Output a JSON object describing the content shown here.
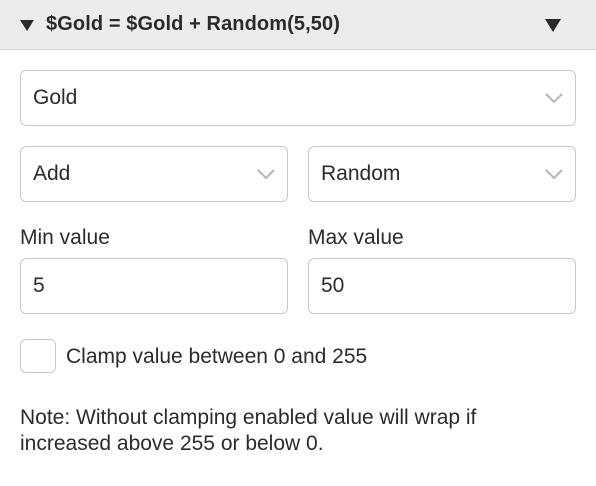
{
  "header": {
    "title": "$Gold = $Gold + Random(5,50)",
    "collapse_icon": "triangle-down-icon",
    "menu_icon": "triangle-down-icon"
  },
  "variable_select": {
    "value": "Gold"
  },
  "operation_select": {
    "value": "Add"
  },
  "source_select": {
    "value": "Random"
  },
  "min": {
    "label": "Min value",
    "value": "5"
  },
  "max": {
    "label": "Max value",
    "value": "50"
  },
  "clamp": {
    "label": "Clamp value between 0 and 255",
    "checked": false
  },
  "note": {
    "line1": "Note: Without clamping enabled value will wrap if",
    "line2": "increased above 255 or below 0."
  },
  "colors": {
    "header_bg": "#ececec",
    "border": "#c9c9c9",
    "text": "#2b2b2b"
  }
}
